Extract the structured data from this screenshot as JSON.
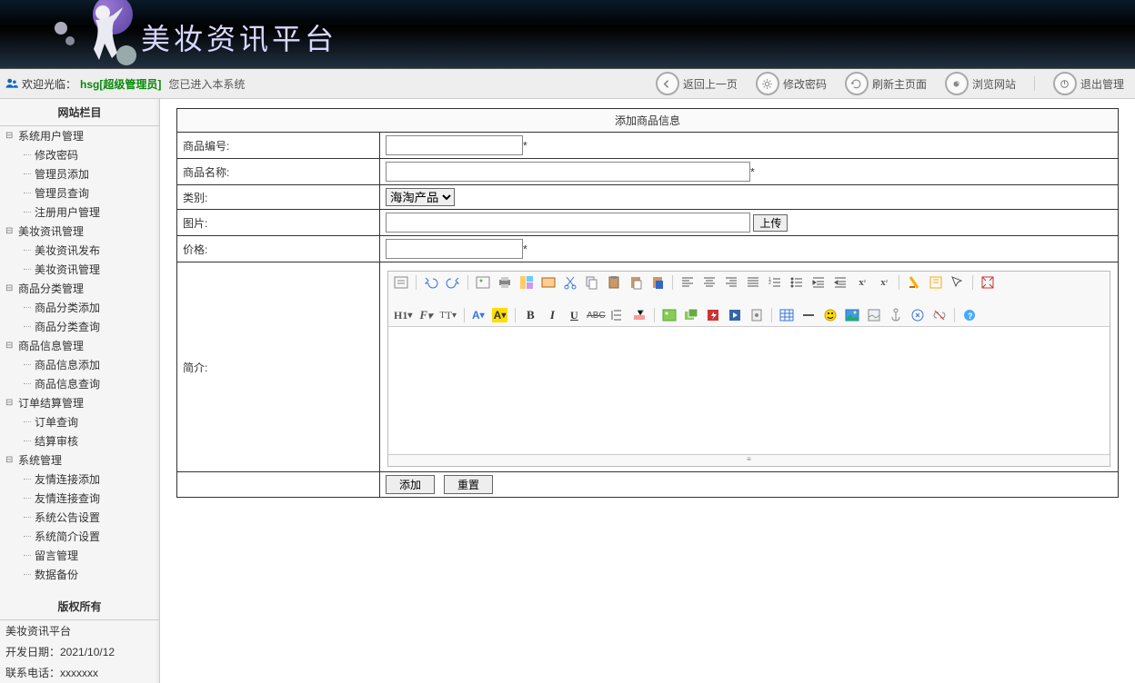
{
  "header": {
    "title": "美妆资讯平台"
  },
  "topbar": {
    "welcome": "欢迎光临：",
    "user": "hsg[超级管理员]",
    "suffix": "您已进入本系统",
    "buttons": {
      "back": "返回上一页",
      "pw": "修改密码",
      "refresh": "刷新主页面",
      "view": "浏览网站",
      "logout": "退出管理"
    }
  },
  "sidebar": {
    "title": "网站栏目",
    "groups": [
      {
        "title": "系统用户管理",
        "items": [
          "修改密码",
          "管理员添加",
          "管理员查询",
          "注册用户管理"
        ]
      },
      {
        "title": "美妆资讯管理",
        "items": [
          "美妆资讯发布",
          "美妆资讯管理"
        ]
      },
      {
        "title": "商品分类管理",
        "items": [
          "商品分类添加",
          "商品分类查询"
        ]
      },
      {
        "title": "商品信息管理",
        "items": [
          "商品信息添加",
          "商品信息查询"
        ]
      },
      {
        "title": "订单结算管理",
        "items": [
          "订单查询",
          "结算审核"
        ]
      },
      {
        "title": "系统管理",
        "items": [
          "友情连接添加",
          "友情连接查询",
          "系统公告设置",
          "系统简介设置",
          "留言管理",
          "数据备份"
        ]
      }
    ],
    "copyright_title": "版权所有",
    "copyright_lines": [
      "美妆资讯平台",
      "开发日期：2021/10/12",
      "联系电话：xxxxxxx"
    ]
  },
  "form": {
    "title": "添加商品信息",
    "fields": {
      "sn": "商品编号:",
      "name": "商品名称:",
      "cat": "类别:",
      "img": "图片:",
      "upload": "上传",
      "price": "价格:",
      "intro": "简介:"
    },
    "star": "*",
    "cat_options": [
      "海淘产品"
    ],
    "submit": "添加",
    "reset": "重置"
  },
  "editor_labels": {
    "h1": "H1",
    "f": "F",
    "t": "T",
    "a": "A",
    "ahl": "A",
    "b": "B",
    "i": "I",
    "u": "U",
    "abc": "ABC"
  }
}
